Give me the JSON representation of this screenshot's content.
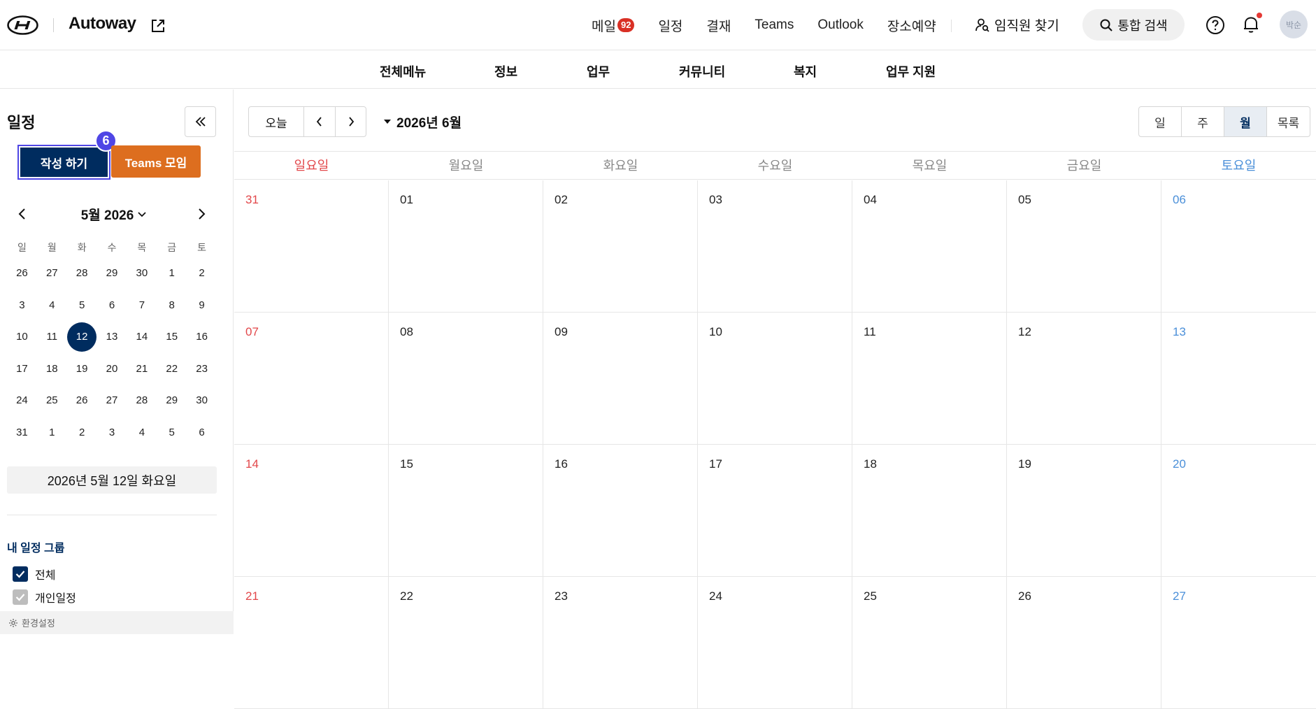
{
  "header": {
    "app_title": "Autoway",
    "nav": [
      {
        "label": "메일",
        "badge": "92"
      },
      {
        "label": "일정"
      },
      {
        "label": "결재"
      },
      {
        "label": "Teams"
      },
      {
        "label": "Outlook"
      },
      {
        "label": "장소예약"
      }
    ],
    "find_employee": "임직원 찾기",
    "search_label": "통합 검색",
    "avatar_text": "박순",
    "notification_dot_color": "#e53935"
  },
  "subnav": [
    "전체메뉴",
    "정보",
    "업무",
    "커뮤니티",
    "복지",
    "업무 지원"
  ],
  "sidebar": {
    "title": "일정",
    "write_label": "작성 하기",
    "write_badge": "6",
    "teams_label": "Teams 모임",
    "mini_title": "5월 2026",
    "weekdays": [
      "일",
      "월",
      "화",
      "수",
      "목",
      "금",
      "토"
    ],
    "weeks": [
      [
        "26",
        "27",
        "28",
        "29",
        "30",
        "1",
        "2"
      ],
      [
        "3",
        "4",
        "5",
        "6",
        "7",
        "8",
        "9"
      ],
      [
        "10",
        "11",
        "12",
        "13",
        "14",
        "15",
        "16"
      ],
      [
        "17",
        "18",
        "19",
        "20",
        "21",
        "22",
        "23"
      ],
      [
        "24",
        "25",
        "26",
        "27",
        "28",
        "29",
        "30"
      ],
      [
        "31",
        "1",
        "2",
        "3",
        "4",
        "5",
        "6"
      ]
    ],
    "selected_day": "12",
    "selected_date_text": "2026년 5월 12일 화요일",
    "group_title": "내 일정 그룹",
    "groups": [
      {
        "label": "전체",
        "checked": true
      },
      {
        "label": "개인일정",
        "checked": true
      }
    ],
    "settings_label": "환경설정"
  },
  "calendar": {
    "today_label": "오늘",
    "month_title": "2026년 6월",
    "views": [
      {
        "label": "일",
        "active": false
      },
      {
        "label": "주",
        "active": false
      },
      {
        "label": "월",
        "active": true
      },
      {
        "label": "목록",
        "active": false
      }
    ],
    "day_headers": [
      "일요일",
      "월요일",
      "화요일",
      "수요일",
      "목요일",
      "금요일",
      "토요일"
    ],
    "weeks": [
      [
        "31",
        "01",
        "02",
        "03",
        "04",
        "05",
        "06"
      ],
      [
        "07",
        "08",
        "09",
        "10",
        "11",
        "12",
        "13"
      ],
      [
        "14",
        "15",
        "16",
        "17",
        "18",
        "19",
        "20"
      ],
      [
        "21",
        "22",
        "23",
        "24",
        "25",
        "26",
        "27"
      ]
    ]
  },
  "colors": {
    "brand_navy": "#002c5f",
    "teams_orange": "#dd6e1f",
    "sunday_red": "#e2474a",
    "saturday_blue": "#4a8fd9",
    "highlight_purple": "#4f46e5"
  }
}
